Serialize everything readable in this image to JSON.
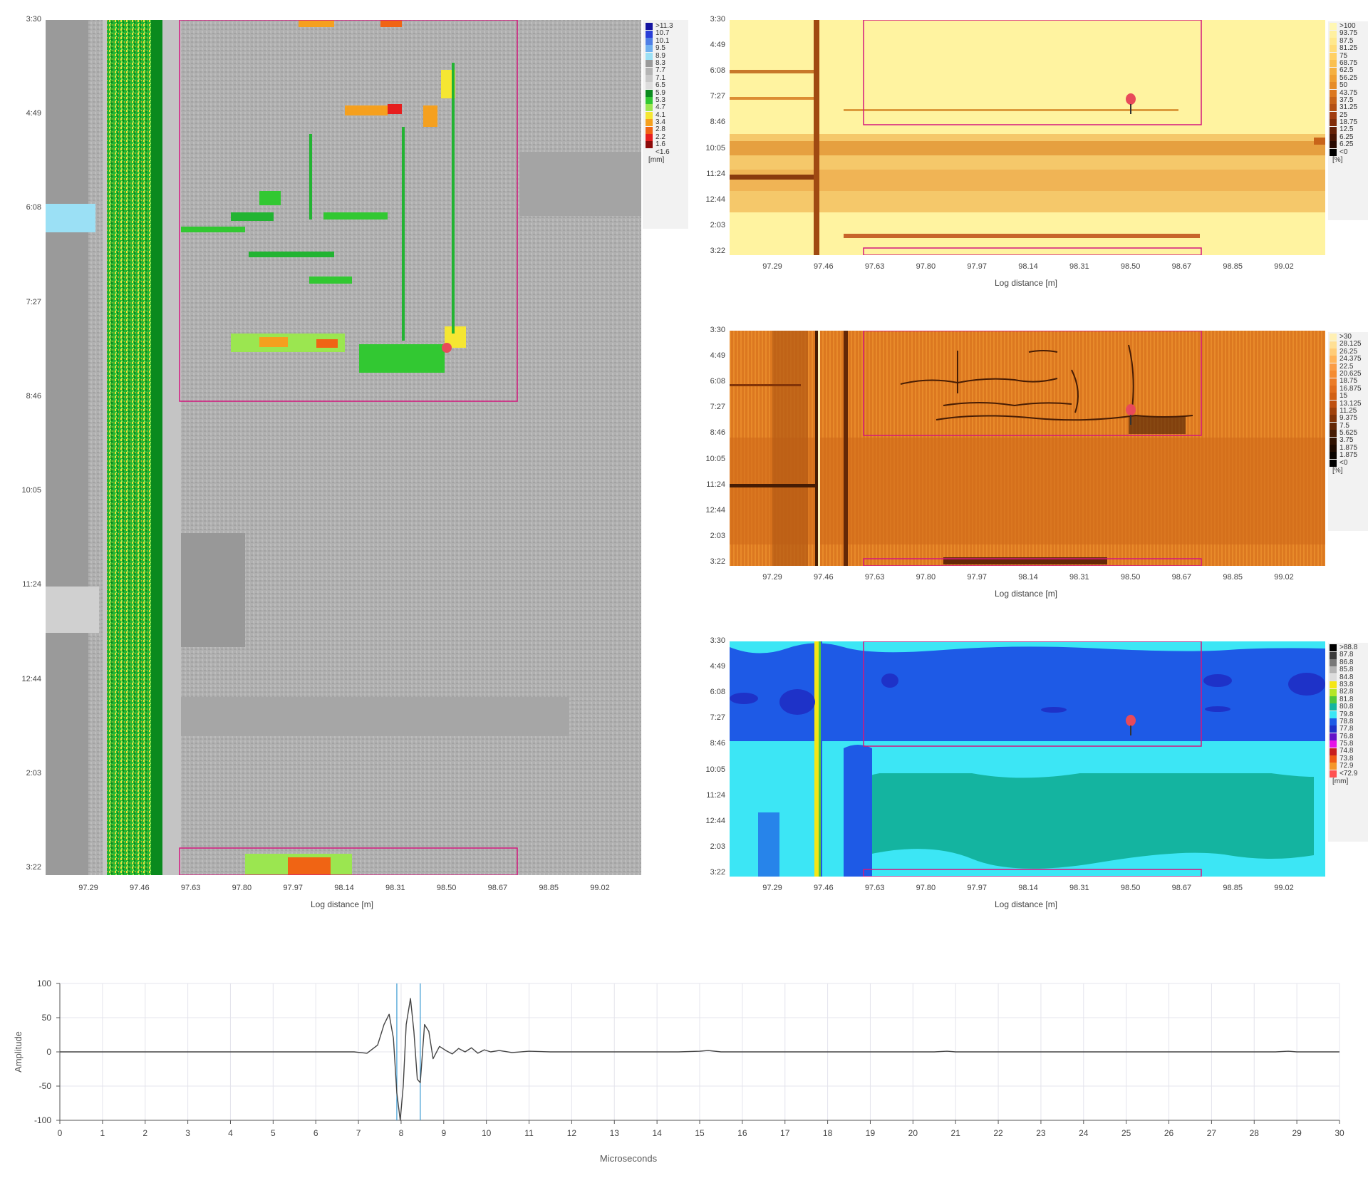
{
  "time_ticks": [
    "3:30",
    "4:49",
    "6:08",
    "7:27",
    "8:46",
    "10:05",
    "11:24",
    "12:44",
    "2:03",
    "3:22"
  ],
  "distance_ticks": [
    "97.29",
    "97.46",
    "97.63",
    "97.80",
    "97.97",
    "98.14",
    "98.31",
    "98.50",
    "98.67",
    "98.85",
    "99.02"
  ],
  "x_axis_title": "Log distance [m]",
  "left_map": {
    "legend": {
      "unit": "[mm]",
      "entries": [
        {
          "label": ">11.3",
          "color": "#1414a0"
        },
        {
          "label": "10.7",
          "color": "#2a3fd8"
        },
        {
          "label": "10.1",
          "color": "#4f7fe6"
        },
        {
          "label": "9.5",
          "color": "#6fb0f0"
        },
        {
          "label": "8.9",
          "color": "#9be0f5"
        },
        {
          "label": "8.3",
          "color": "#9a9a9a"
        },
        {
          "label": "7.7",
          "color": "#b4b4b4"
        },
        {
          "label": "7.1",
          "color": "#c8c8c8"
        },
        {
          "label": "6.5",
          "color": "#dcdcdc"
        },
        {
          "label": "5.9",
          "color": "#0a8a1e"
        },
        {
          "label": "5.3",
          "color": "#32c832"
        },
        {
          "label": "4.7",
          "color": "#9be650"
        },
        {
          "label": "4.1",
          "color": "#f5e632"
        },
        {
          "label": "3.4",
          "color": "#f5a01e"
        },
        {
          "label": "2.8",
          "color": "#f06414"
        },
        {
          "label": "2.2",
          "color": "#e61e1e"
        },
        {
          "label": "1.6",
          "color": "#8c0a0a"
        },
        {
          "label": "<1.6",
          "color": "#f2f2f2"
        }
      ]
    }
  },
  "top_map": {
    "legend": {
      "unit": "[%]",
      "entries": [
        {
          "label": ">100",
          "color": "#fff7b4"
        },
        {
          "label": "93.75",
          "color": "#fff0a0"
        },
        {
          "label": "87.5",
          "color": "#ffe88c"
        },
        {
          "label": "81.25",
          "color": "#ffdc78"
        },
        {
          "label": "75",
          "color": "#ffd064"
        },
        {
          "label": "68.75",
          "color": "#fac050"
        },
        {
          "label": "62.5",
          "color": "#f5b040"
        },
        {
          "label": "56.25",
          "color": "#f0a032"
        },
        {
          "label": "50",
          "color": "#e68c28"
        },
        {
          "label": "43.75",
          "color": "#dc7820"
        },
        {
          "label": "37.5",
          "color": "#c8641a"
        },
        {
          "label": "31.25",
          "color": "#b45014"
        },
        {
          "label": "25",
          "color": "#a03c10"
        },
        {
          "label": "18.75",
          "color": "#822d0a"
        },
        {
          "label": "12.5",
          "color": "#642008"
        },
        {
          "label": "6.25",
          "color": "#461404"
        },
        {
          "label": "6.25",
          "color": "#280a02"
        },
        {
          "label": "<0",
          "color": "#000000"
        }
      ]
    }
  },
  "mid_map": {
    "legend": {
      "unit": "[%]",
      "entries": [
        {
          "label": ">30",
          "color": "#fff0b4"
        },
        {
          "label": "28.125",
          "color": "#ffe096"
        },
        {
          "label": "26.25",
          "color": "#ffcc78"
        },
        {
          "label": "24.375",
          "color": "#ffb45a"
        },
        {
          "label": "22.5",
          "color": "#fa9c46"
        },
        {
          "label": "20.625",
          "color": "#f58c32"
        },
        {
          "label": "18.75",
          "color": "#eb7c28"
        },
        {
          "label": "16.875",
          "color": "#e16e1e"
        },
        {
          "label": "15",
          "color": "#d26014"
        },
        {
          "label": "13.125",
          "color": "#be5010"
        },
        {
          "label": "11.25",
          "color": "#a0420c"
        },
        {
          "label": "9.375",
          "color": "#823408"
        },
        {
          "label": "7.5",
          "color": "#642806"
        },
        {
          "label": "5.625",
          "color": "#461c04"
        },
        {
          "label": "3.75",
          "color": "#301202"
        },
        {
          "label": "1.875",
          "color": "#1e0a00"
        },
        {
          "label": "1.875",
          "color": "#0a0400"
        },
        {
          "label": "<0",
          "color": "#000000"
        }
      ]
    }
  },
  "bot_map": {
    "legend": {
      "unit": "[mm]",
      "entries": [
        {
          "label": ">88.8",
          "color": "#000000"
        },
        {
          "label": "87.8",
          "color": "#3c3c3c"
        },
        {
          "label": "86.8",
          "color": "#787878"
        },
        {
          "label": "85.8",
          "color": "#b4b4b4"
        },
        {
          "label": "84.8",
          "color": "#dcdcdc"
        },
        {
          "label": "83.8",
          "color": "#f5e614"
        },
        {
          "label": "82.8",
          "color": "#b4e628"
        },
        {
          "label": "81.8",
          "color": "#50c83c"
        },
        {
          "label": "80.8",
          "color": "#14b4a0"
        },
        {
          "label": "79.8",
          "color": "#3ce6f5"
        },
        {
          "label": "78.8",
          "color": "#1e5ae6"
        },
        {
          "label": "77.8",
          "color": "#1e32c8"
        },
        {
          "label": "76.8",
          "color": "#6414c8"
        },
        {
          "label": "75.8",
          "color": "#e614e6"
        },
        {
          "label": "74.8",
          "color": "#c81e1e"
        },
        {
          "label": "73.8",
          "color": "#f05a14"
        },
        {
          "label": "72.9",
          "color": "#f59628"
        },
        {
          "label": "<72.9",
          "color": "#ff5050"
        }
      ]
    }
  },
  "waveform": {
    "y_axis_title": "Amplitude",
    "x_axis_title": "Microseconds",
    "y_ticks": [
      "100",
      "50",
      "0",
      "-50",
      "-100"
    ],
    "x_ticks": [
      "0",
      "1",
      "2",
      "3",
      "4",
      "5",
      "6",
      "7",
      "8",
      "9",
      "10",
      "11",
      "12",
      "13",
      "14",
      "15",
      "16",
      "17",
      "18",
      "19",
      "20",
      "21",
      "22",
      "23",
      "24",
      "25",
      "26",
      "27",
      "28",
      "29",
      "30"
    ],
    "chart_data": {
      "type": "line",
      "xlabel": "Microseconds",
      "ylabel": "Amplitude",
      "xlim": [
        0,
        30
      ],
      "ylim": [
        -100,
        100
      ],
      "grid": true,
      "cursor_lines_x": [
        7.9,
        8.45
      ],
      "series": [
        {
          "x": [
            0,
            6.9,
            7.2,
            7.45,
            7.6,
            7.72,
            7.82,
            7.9,
            7.98,
            8.05,
            8.12,
            8.22,
            8.3,
            8.38,
            8.45,
            8.55,
            8.65,
            8.75,
            8.9,
            9.05,
            9.2,
            9.35,
            9.5,
            9.65,
            9.8,
            9.95,
            10.1,
            10.3,
            10.6,
            11.0,
            11.5,
            12.0,
            13.0,
            14.5,
            15.0,
            15.2,
            15.5,
            16.0,
            20.5,
            20.8,
            21.0,
            28.5,
            28.8,
            29.0,
            30.0
          ],
          "y": [
            0,
            0,
            -2,
            10,
            40,
            55,
            20,
            -60,
            -100,
            -50,
            40,
            78,
            30,
            -40,
            -45,
            40,
            30,
            -10,
            8,
            2,
            -3,
            5,
            0,
            6,
            -2,
            3,
            0,
            2,
            -1,
            1,
            0,
            0,
            0,
            0,
            1,
            2,
            0,
            0,
            0,
            1,
            0,
            0,
            1,
            0,
            0
          ]
        }
      ]
    }
  }
}
